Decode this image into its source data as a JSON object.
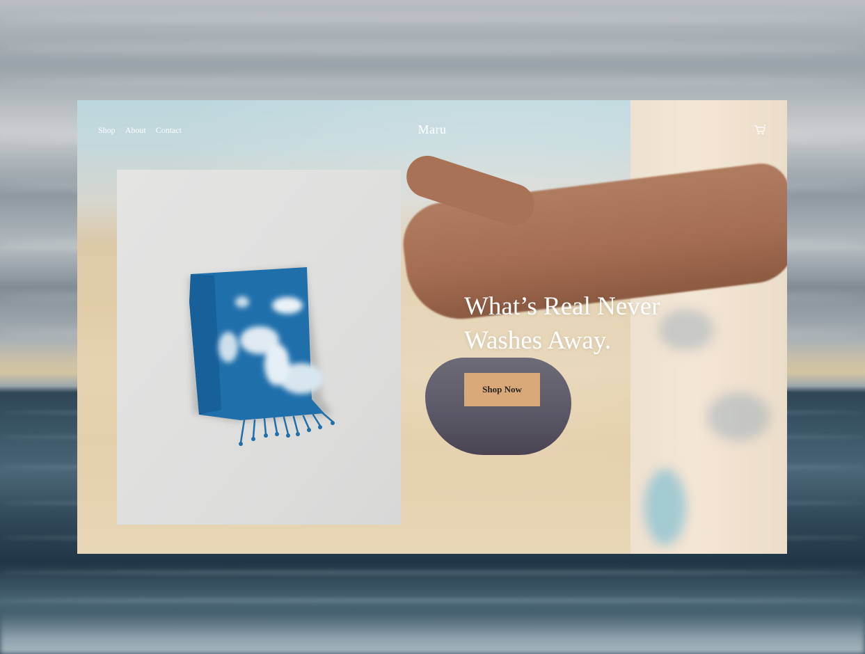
{
  "nav": {
    "items": [
      {
        "label": "Shop"
      },
      {
        "label": "About"
      },
      {
        "label": "Contact"
      }
    ]
  },
  "brand": {
    "name": "Maru"
  },
  "header": {
    "cart_icon": "cart-icon"
  },
  "hero": {
    "headline_line1": "What’s Real Never",
    "headline_line2": "Washes Away.",
    "cta_label": "Shop Now"
  },
  "product_image": {
    "subject": "tie-dye-towel"
  },
  "colors": {
    "accent": "#d9a97a",
    "towel_blue": "#1f6fab",
    "text_on_image": "#ffffff"
  }
}
